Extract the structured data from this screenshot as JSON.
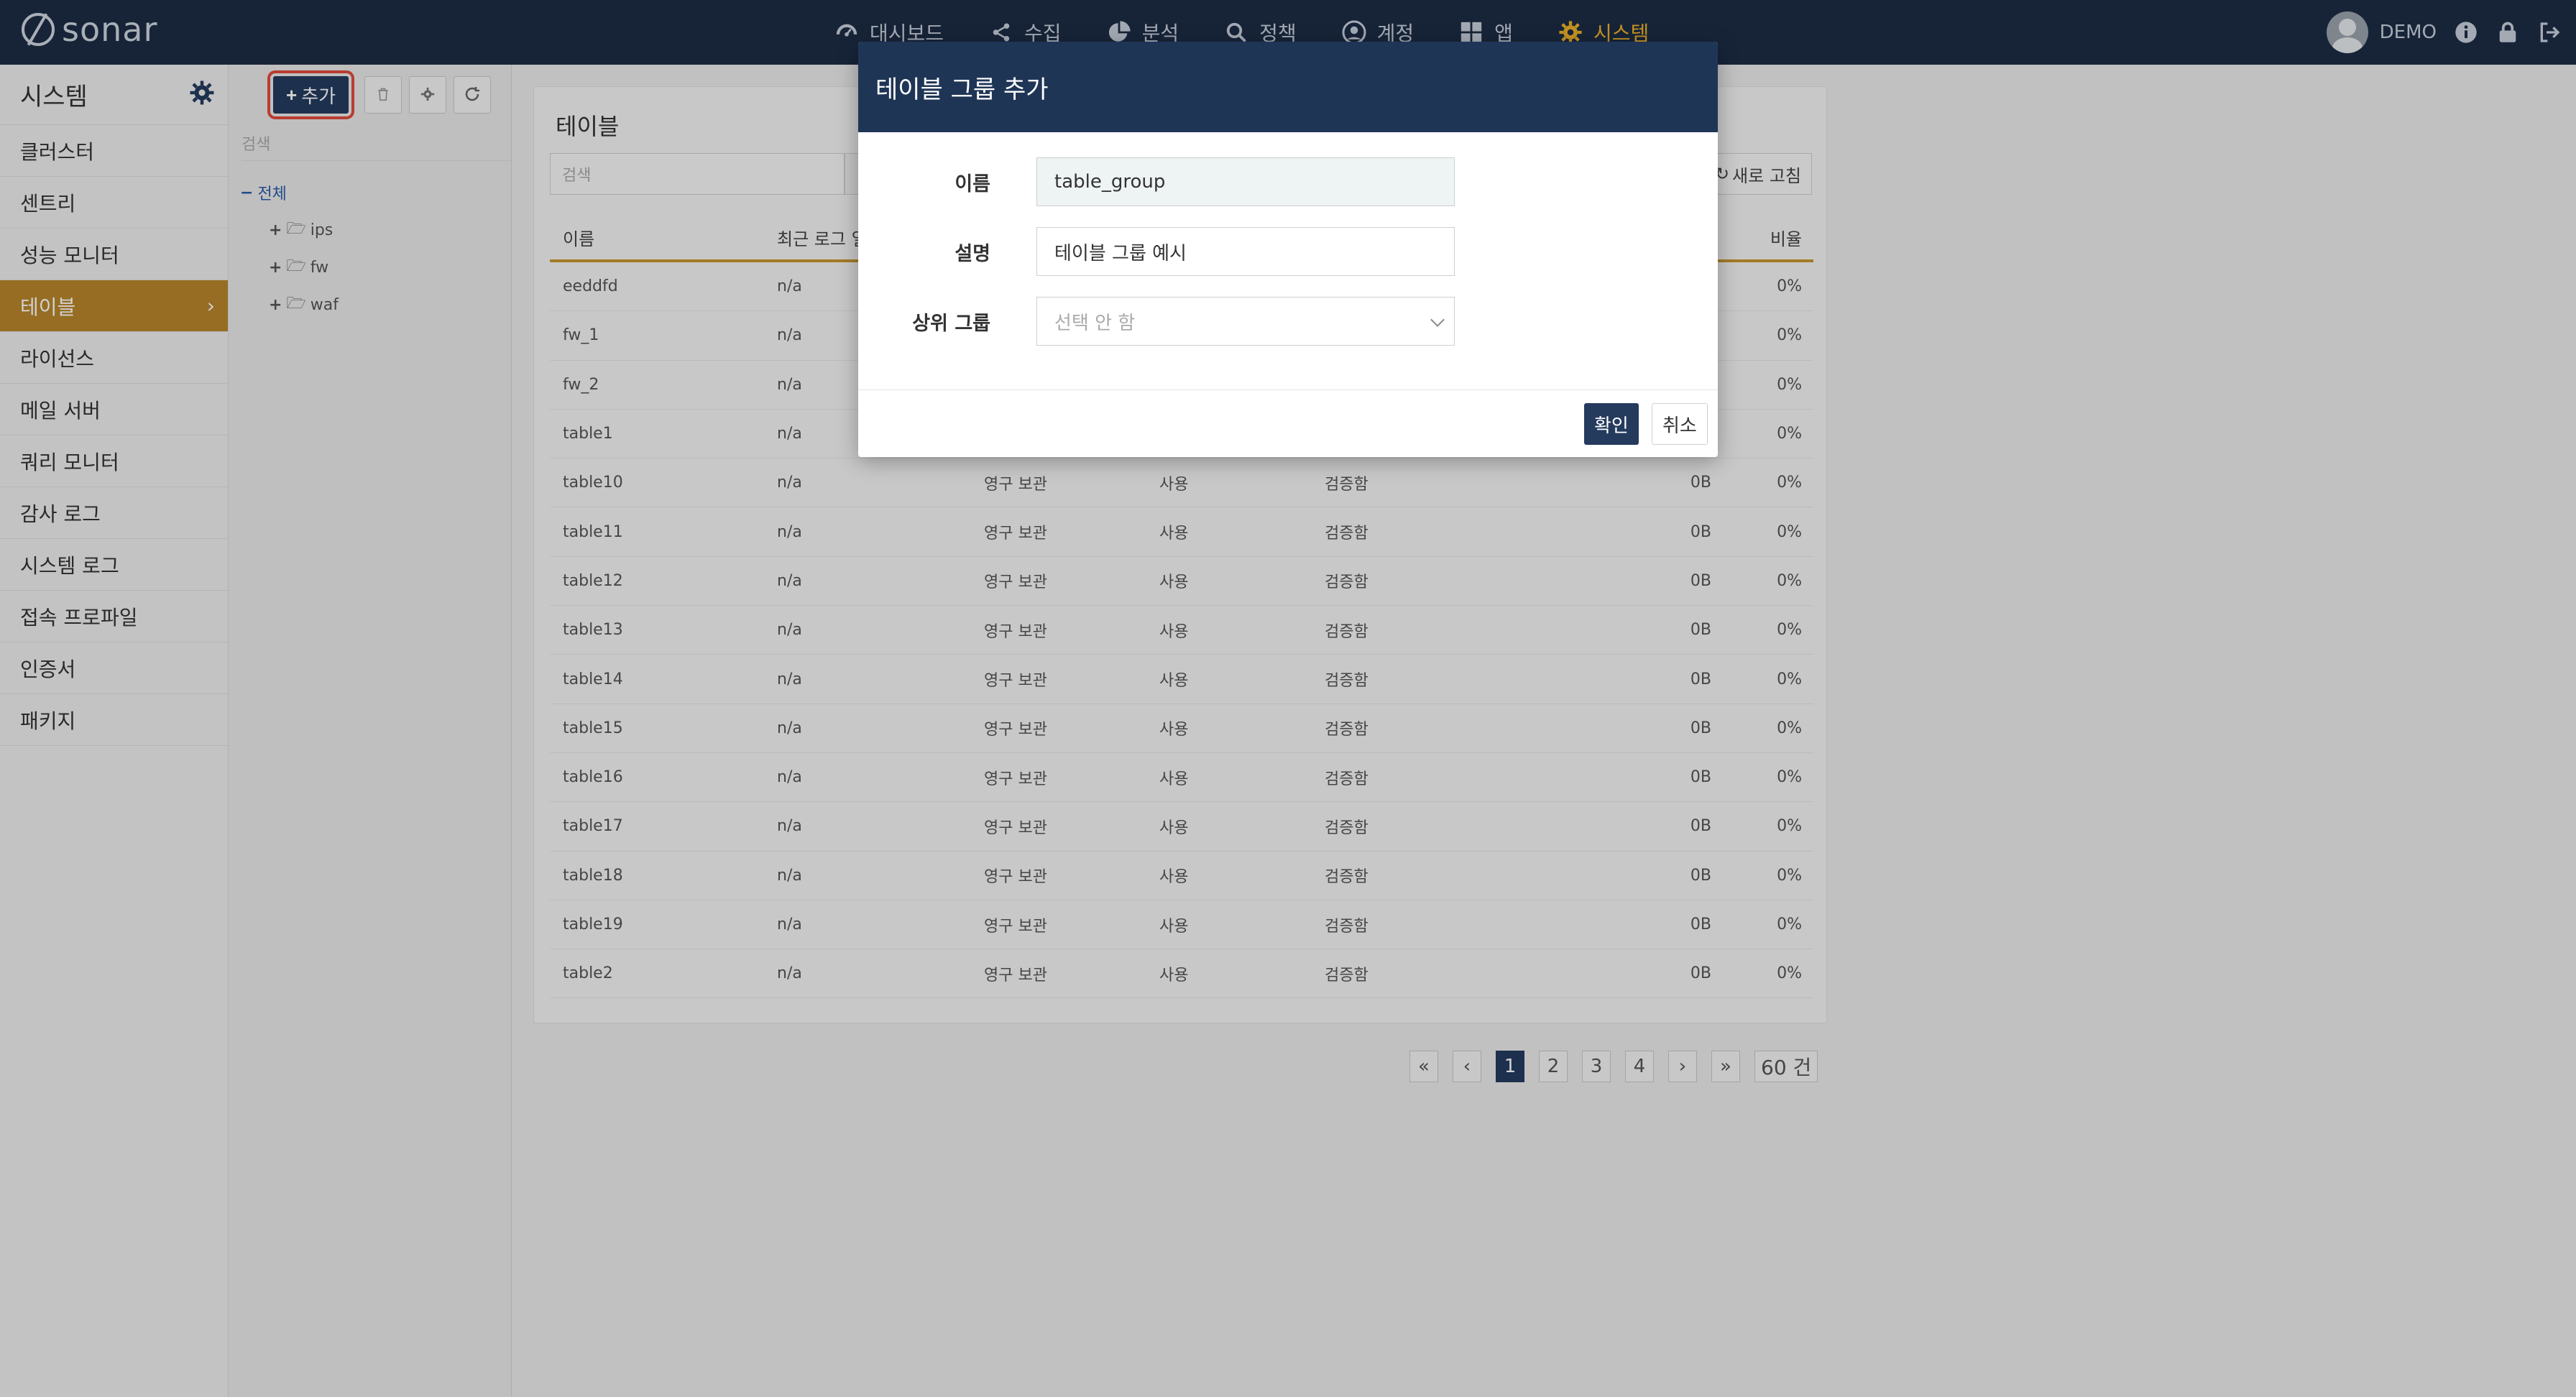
{
  "app": {
    "brand": "sonar"
  },
  "topnav": {
    "items": [
      {
        "label": "대시보드",
        "icon": "dashboard-icon"
      },
      {
        "label": "수집",
        "icon": "share-icon"
      },
      {
        "label": "분석",
        "icon": "pie-chart-icon"
      },
      {
        "label": "정책",
        "icon": "search-icon"
      },
      {
        "label": "계정",
        "icon": "user-circle-icon"
      },
      {
        "label": "앱",
        "icon": "grid-icon"
      },
      {
        "label": "시스템",
        "icon": "gear-icon",
        "active": true
      }
    ],
    "user": "DEMO"
  },
  "sidebar": {
    "title": "시스템",
    "items": [
      {
        "label": "클러스터"
      },
      {
        "label": "센트리"
      },
      {
        "label": "성능 모니터"
      },
      {
        "label": "테이블",
        "active": true
      },
      {
        "label": "라이선스"
      },
      {
        "label": "메일 서버"
      },
      {
        "label": "쿼리 모니터"
      },
      {
        "label": "감사 로그"
      },
      {
        "label": "시스템 로그"
      },
      {
        "label": "접속 프로파일"
      },
      {
        "label": "인증서"
      },
      {
        "label": "패키지"
      }
    ]
  },
  "treepanel": {
    "add_label": "추가",
    "search_placeholder": "검색",
    "root": "전체",
    "children": [
      "ips",
      "fw",
      "waf"
    ]
  },
  "main": {
    "title": "테이블",
    "search_placeholder": "검색",
    "refresh_label": "새로 고침",
    "columns": [
      "이름",
      "최근 로그 일",
      "",
      "",
      "",
      "",
      "비율"
    ],
    "rows": [
      [
        "eeddfd",
        "n/a",
        "",
        "",
        "",
        "",
        "0%"
      ],
      [
        "fw_1",
        "n/a",
        "",
        "",
        "",
        "",
        "0%"
      ],
      [
        "fw_2",
        "n/a",
        "",
        "",
        "",
        "",
        "0%"
      ],
      [
        "table1",
        "n/a",
        "",
        "",
        "",
        "",
        "0%"
      ],
      [
        "table10",
        "n/a",
        "영구 보관",
        "사용",
        "검증함",
        "0B",
        "0%"
      ],
      [
        "table11",
        "n/a",
        "영구 보관",
        "사용",
        "검증함",
        "0B",
        "0%"
      ],
      [
        "table12",
        "n/a",
        "영구 보관",
        "사용",
        "검증함",
        "0B",
        "0%"
      ],
      [
        "table13",
        "n/a",
        "영구 보관",
        "사용",
        "검증함",
        "0B",
        "0%"
      ],
      [
        "table14",
        "n/a",
        "영구 보관",
        "사용",
        "검증함",
        "0B",
        "0%"
      ],
      [
        "table15",
        "n/a",
        "영구 보관",
        "사용",
        "검증함",
        "0B",
        "0%"
      ],
      [
        "table16",
        "n/a",
        "영구 보관",
        "사용",
        "검증함",
        "0B",
        "0%"
      ],
      [
        "table17",
        "n/a",
        "영구 보관",
        "사용",
        "검증함",
        "0B",
        "0%"
      ],
      [
        "table18",
        "n/a",
        "영구 보관",
        "사용",
        "검증함",
        "0B",
        "0%"
      ],
      [
        "table19",
        "n/a",
        "영구 보관",
        "사용",
        "검증함",
        "0B",
        "0%"
      ],
      [
        "table2",
        "n/a",
        "영구 보관",
        "사용",
        "검증함",
        "0B",
        "0%"
      ]
    ],
    "pager": {
      "first": "«",
      "prev": "‹",
      "pages": [
        "1",
        "2",
        "3",
        "4"
      ],
      "active": "1",
      "next": "›",
      "last": "»",
      "count": "60 건"
    }
  },
  "modal": {
    "title": "테이블 그룹 추가",
    "name_label": "이름",
    "name_value": "table_group",
    "desc_label": "설명",
    "desc_value": "테이블 그룹 예시",
    "parent_label": "상위 그룹",
    "parent_value": "선택 안 함",
    "ok_label": "확인",
    "cancel_label": "취소"
  },
  "colors": {
    "nav_bg": "#1d2d45",
    "accent": "#b8862a",
    "active_nav": "#f0b429",
    "primary_button": "#243b5e",
    "highlight_outline": "#e24a3b"
  }
}
